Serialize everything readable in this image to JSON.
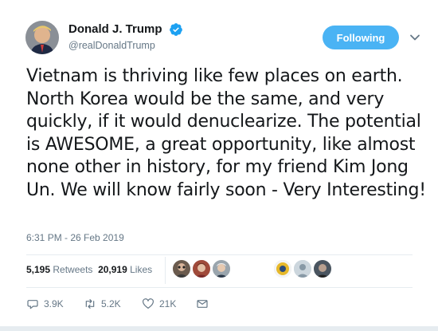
{
  "author": {
    "name": "Donald J. Trump",
    "handle": "@realDonaldTrump",
    "verified": true
  },
  "follow_button": {
    "label": "Following"
  },
  "tweet": {
    "text": "Vietnam is thriving like few places on earth. North Korea would be the same, and very quickly, if it would denuclearize. The potential is AWESOME, a great opportunity, like almost none other in history, for my friend Kim Jong Un. We will know fairly soon - Very Interesting!",
    "timestamp": "6:31 PM - 26 Feb 2019"
  },
  "stats": {
    "retweets_count": "5,195",
    "retweets_label": "Retweets",
    "likes_count": "20,919",
    "likes_label": "Likes"
  },
  "actions": {
    "reply_count": "3.9K",
    "retweet_count": "5.2K",
    "like_count": "21K"
  },
  "icons": {
    "verified": "verified-badge-icon",
    "caret": "chevron-down-icon",
    "reply": "reply-icon",
    "retweet": "retweet-icon",
    "like": "heart-icon",
    "dm": "envelope-icon"
  },
  "colors": {
    "accent": "#1da1f2",
    "follow_button_bg": "#4ab3f4",
    "text_primary": "#14171a",
    "text_secondary": "#657786",
    "divider": "#e6ecf0"
  }
}
